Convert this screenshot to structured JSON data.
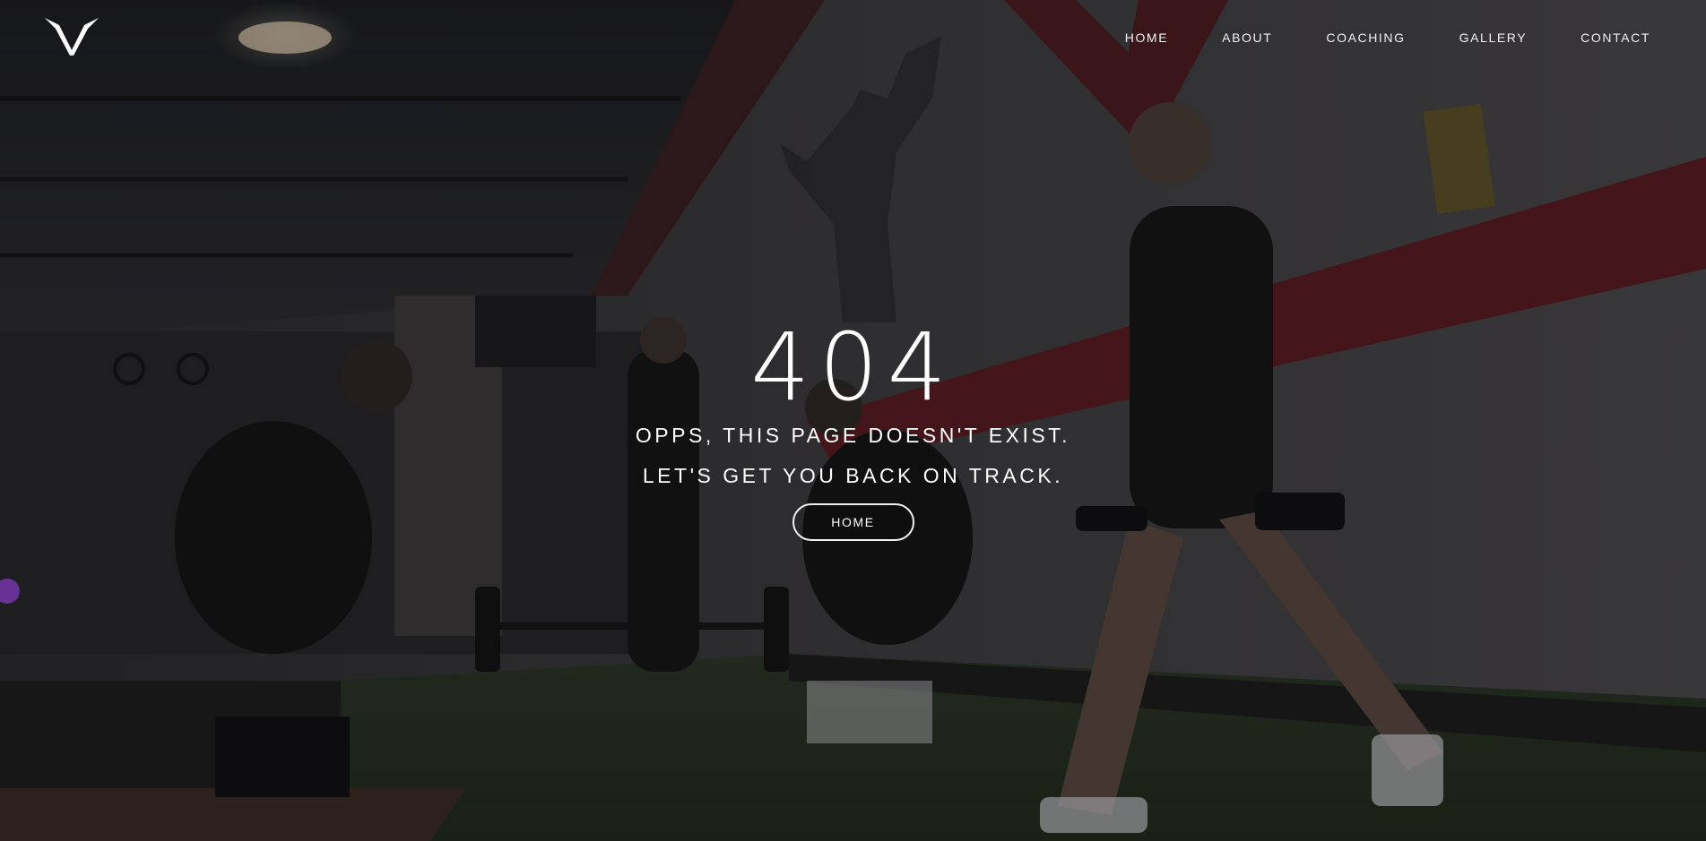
{
  "header": {
    "logo_icon": "v-wing-logo-icon",
    "nav": [
      {
        "label": "HOME"
      },
      {
        "label": "ABOUT"
      },
      {
        "label": "COACHING"
      },
      {
        "label": "GALLERY"
      },
      {
        "label": "CONTACT"
      }
    ]
  },
  "error": {
    "code": "404",
    "message_line_1": "OPPS, THIS PAGE DOESN'T EXIST.",
    "message_line_2": "LET'S GET YOU BACK ON TRACK.",
    "button_label": "HOME"
  },
  "colors": {
    "text": "#ffffff",
    "accent_red": "#7a1c24",
    "turf_green": "#2f3d2a"
  }
}
